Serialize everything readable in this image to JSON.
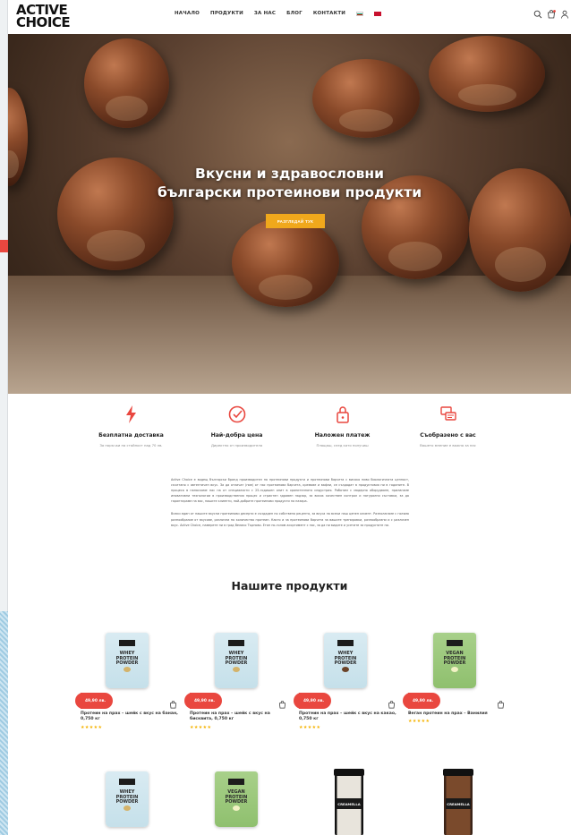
{
  "brand": {
    "line1": "ACTIVE",
    "line2": "CHOICE"
  },
  "nav": [
    {
      "label": "НАЧАЛО",
      "active": true
    },
    {
      "label": "ПРОДУКТИ",
      "active": false
    },
    {
      "label": "ЗА НАС",
      "active": false
    },
    {
      "label": "БЛОГ",
      "active": false
    },
    {
      "label": "КОНТАКТИ",
      "active": false
    }
  ],
  "hero": {
    "title_line1": "Вкусни и здравословни",
    "title_line2": "български протеинови продукти",
    "button": "РАЗГЛЕДАЙ ТУК"
  },
  "features": [
    {
      "icon": "bolt-icon",
      "title": "Безплатна доставка",
      "subtitle": "За поръчки на стойност над 70 лв."
    },
    {
      "icon": "check-circle-icon",
      "title": "Най-добра цена",
      "subtitle": "Директно от производителя"
    },
    {
      "icon": "lock-icon",
      "title": "Наложен платеж",
      "subtitle": "Плащаш, след като получиш"
    },
    {
      "icon": "chat-icon",
      "title": "Съобразено с вас",
      "subtitle": "Вашето мнение е важно за нас"
    }
  ],
  "about": {
    "p1": "Active Choice е водещ български бранд производител на протеинови продукти и протеинови барчета с високо ниво биологичната ценност, съчетано с автентичен вкус. За да отличат (ние) от нас протеинови барчета, кремове и вафли, се създадат в продуктовия ни в годините. В процеса в напаскаме нас на от специалисти с 25-годишен опит в хранителната индустрия. Работим с модерно оборудване, прилагаме иновативни технологии в производствения процес и стриктен здравен надзор, за висок качествен контрол и натурални съставки, за да гарантираме на вас, нашите клиенти, най-добрите протеинови продукти на пазара.",
    "p2": "Всеки един от нашите вкусни протеинови десерти е създаден по собствена рецепта, за вкуса на всеки наш ценен клиент. Разполагаме с голямо разнообразие от вкусове, различни по количество протеин. Както и за протеинови барчета за вашите тренировки, разнообразни и с различен вкус. Active Choice, намерете ни в град Велико Търново. Етап по-голям асортимент с нас, за да ни видите и усетите за продуктите ни."
  },
  "section_title": "Нашите продукти",
  "products": [
    {
      "kind": "pouch",
      "color": "blue",
      "flavor": "",
      "label": "WHEY PROTEIN POWDER",
      "price": "49,90 лв.",
      "name": "Протеин на прах – шейк с вкус на банан, 0,750 кг",
      "rating": 5
    },
    {
      "kind": "pouch",
      "color": "blue",
      "flavor": "",
      "label": "WHEY PROTEIN POWDER",
      "price": "49,90 лв.",
      "name": "Протеин на прах – шейк с вкус на бисквита, 0,750 кг",
      "rating": 5
    },
    {
      "kind": "pouch",
      "color": "blue",
      "flavor": "choc",
      "label": "WHEY PROTEIN POWDER",
      "price": "49,90 лв.",
      "name": "Протеин на прах – шейк с вкус на какао, 0,750 кг",
      "rating": 5
    },
    {
      "kind": "pouch",
      "color": "green",
      "flavor": "",
      "label": "VEGAN PROTEIN POWDER",
      "price": "49,90 лв.",
      "name": "Веган протеин на прах – Ванилия",
      "rating": 5
    },
    {
      "kind": "pouch",
      "color": "blue",
      "flavor": "",
      "label": "WHEY PROTEIN POWDER"
    },
    {
      "kind": "pouch",
      "color": "green",
      "flavor": "",
      "label": "VEGAN PROTEIN POWDER"
    },
    {
      "kind": "jar",
      "color": "white",
      "label": "CREAMELLA"
    },
    {
      "kind": "jar",
      "color": "choc",
      "label": "CREAMELLA"
    }
  ],
  "colors": {
    "accent": "#f0a81c",
    "price_badge": "#e9473f",
    "feature_icon": "#e9473f",
    "stars": "#f5b301"
  }
}
